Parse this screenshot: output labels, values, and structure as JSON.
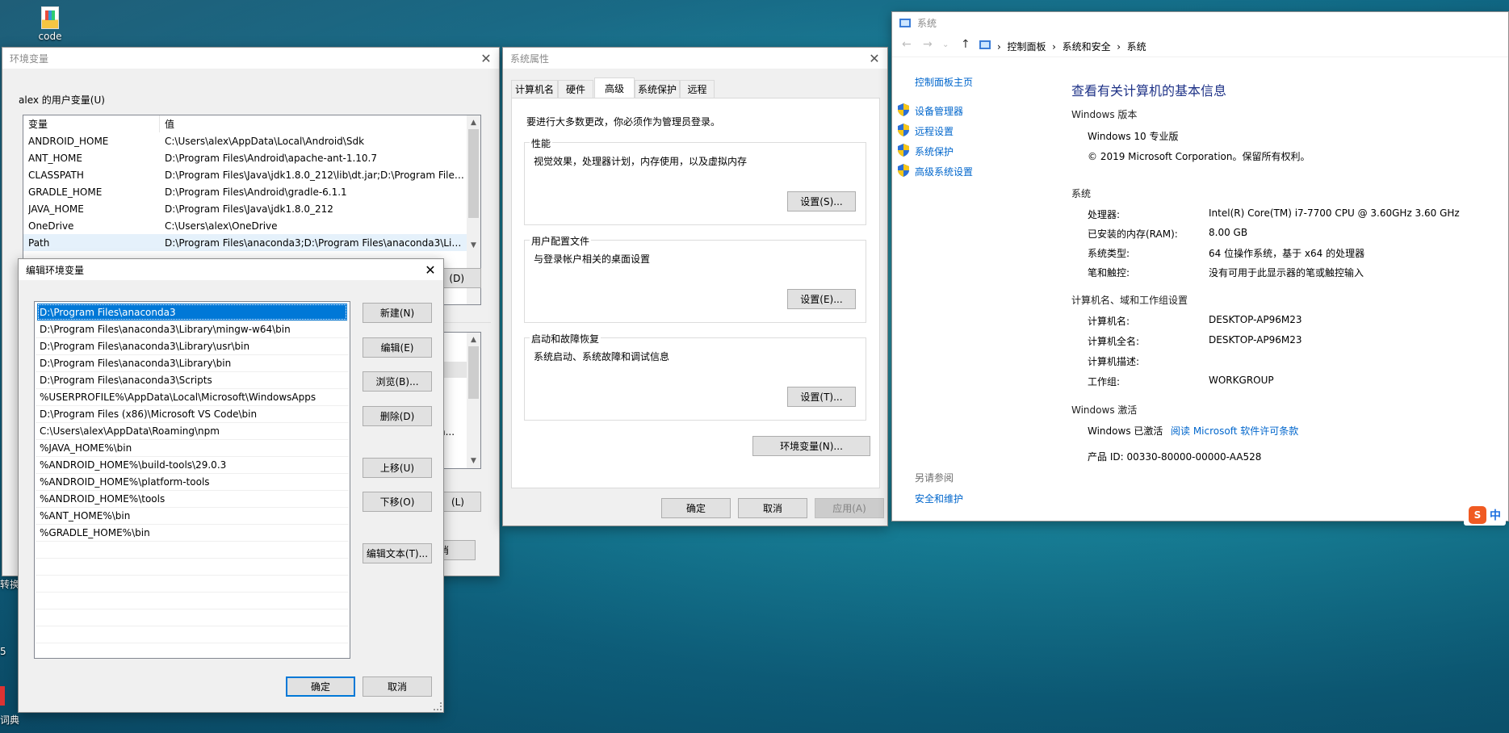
{
  "desktop": {
    "icon_code_label": "code",
    "left_edge_labels": [
      "转换",
      "5",
      "词典"
    ]
  },
  "env_window": {
    "title": "环境变量",
    "user_vars_label": "alex 的用户变量(U)",
    "columns": [
      "变量",
      "值"
    ],
    "rows": [
      {
        "name": "ANDROID_HOME",
        "value": "C:\\Users\\alex\\AppData\\Local\\Android\\Sdk"
      },
      {
        "name": "ANT_HOME",
        "value": "D:\\Program Files\\Android\\apache-ant-1.10.7"
      },
      {
        "name": "CLASSPATH",
        "value": "D:\\Program Files\\Java\\jdk1.8.0_212\\lib\\dt.jar;D:\\Program Files..."
      },
      {
        "name": "GRADLE_HOME",
        "value": "D:\\Program Files\\Android\\gradle-6.1.1"
      },
      {
        "name": "JAVA_HOME",
        "value": "D:\\Program Files\\Java\\jdk1.8.0_212"
      },
      {
        "name": "OneDrive",
        "value": "C:\\Users\\alex\\OneDrive"
      },
      {
        "name": "Path",
        "value": "D:\\Program Files\\anaconda3;D:\\Program Files\\anaconda3\\Lib..."
      }
    ],
    "partial_button_1": "(D)",
    "partial_button_2": "(L)",
    "partial_button_3": "消",
    "partial_row_text": "n..."
  },
  "edit_window": {
    "title": "编辑环境变量",
    "paths": [
      "D:\\Program Files\\anaconda3",
      "D:\\Program Files\\anaconda3\\Library\\mingw-w64\\bin",
      "D:\\Program Files\\anaconda3\\Library\\usr\\bin",
      "D:\\Program Files\\anaconda3\\Library\\bin",
      "D:\\Program Files\\anaconda3\\Scripts",
      "%USERPROFILE%\\AppData\\Local\\Microsoft\\WindowsApps",
      "D:\\Program Files (x86)\\Microsoft VS Code\\bin",
      "C:\\Users\\alex\\AppData\\Roaming\\npm",
      "%JAVA_HOME%\\bin",
      "%ANDROID_HOME%\\build-tools\\29.0.3",
      "%ANDROID_HOME%\\platform-tools",
      "%ANDROID_HOME%\\tools",
      "%ANT_HOME%\\bin",
      "%GRADLE_HOME%\\bin"
    ],
    "buttons": {
      "new": "新建(N)",
      "edit": "编辑(E)",
      "browse": "浏览(B)...",
      "delete": "删除(D)",
      "move_up": "上移(U)",
      "move_down": "下移(O)",
      "edit_text": "编辑文本(T)...",
      "ok": "确定",
      "cancel": "取消"
    }
  },
  "sysprop_window": {
    "title": "系统属性",
    "tabs": [
      "计算机名",
      "硬件",
      "高级",
      "系统保护",
      "远程"
    ],
    "admin_note": "要进行大多数更改，你必须作为管理员登录。",
    "performance": {
      "label": "性能",
      "desc": "视觉效果，处理器计划，内存使用，以及虚拟内存",
      "button": "设置(S)..."
    },
    "profile": {
      "label": "用户配置文件",
      "desc": "与登录帐户相关的桌面设置",
      "button": "设置(E)..."
    },
    "startup": {
      "label": "启动和故障恢复",
      "desc": "系统启动、系统故障和调试信息",
      "button": "设置(T)..."
    },
    "env_button": "环境变量(N)...",
    "ok": "确定",
    "cancel": "取消",
    "apply": "应用(A)"
  },
  "system_window": {
    "title": "系统",
    "breadcrumb": [
      "控制面板",
      "系统和安全",
      "系统"
    ],
    "sidebar_home": "控制面板主页",
    "sidebar_links": [
      "设备管理器",
      "远程设置",
      "系统保护",
      "高级系统设置"
    ],
    "see_also_label": "另请参阅",
    "see_also_link": "安全和维护",
    "heading": "查看有关计算机的基本信息",
    "windows_edition_label": "Windows 版本",
    "edition": "Windows 10 专业版",
    "copyright": "© 2019 Microsoft Corporation。保留所有权利。",
    "system_label": "系统",
    "system_rows": [
      {
        "k": "处理器:",
        "v": "Intel(R) Core(TM) i7-7700 CPU @ 3.60GHz   3.60 GHz"
      },
      {
        "k": "已安装的内存(RAM):",
        "v": "8.00 GB"
      },
      {
        "k": "系统类型:",
        "v": "64 位操作系统，基于 x64 的处理器"
      },
      {
        "k": "笔和触控:",
        "v": "没有可用于此显示器的笔或触控输入"
      }
    ],
    "computer_label": "计算机名、域和工作组设置",
    "computer_rows": [
      {
        "k": "计算机名:",
        "v": "DESKTOP-AP96M23"
      },
      {
        "k": "计算机全名:",
        "v": "DESKTOP-AP96M23"
      },
      {
        "k": "计算机描述:",
        "v": ""
      },
      {
        "k": "工作组:",
        "v": "WORKGROUP"
      }
    ],
    "activation_label": "Windows 激活",
    "activated": "Windows 已激活",
    "license_link": "阅读 Microsoft 软件许可条款",
    "product_id": "产品 ID: 00330-80000-00000-AA528"
  },
  "ime": {
    "logo": "S",
    "mode": "中"
  },
  "colors": {
    "accent": "#0078d7",
    "link": "#0066cc",
    "heading": "#1e3287"
  }
}
